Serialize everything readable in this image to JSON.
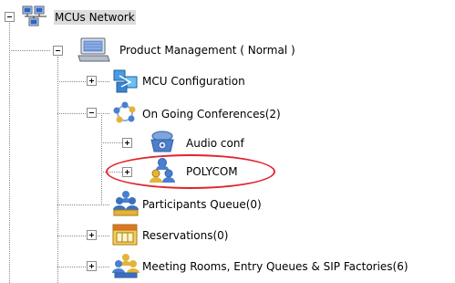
{
  "tree": {
    "root": {
      "label": "MCUs Network",
      "icon": "network-computers-icon"
    },
    "mcu": {
      "label": "Product Management  ( Normal )",
      "icon": "mcu-server-icon"
    },
    "items": [
      {
        "key": "mcu_config",
        "label": "MCU Configuration",
        "icon": "configuration-icon"
      },
      {
        "key": "ongoing",
        "label": "On Going Conferences(2)",
        "icon": "conferences-icon"
      },
      {
        "key": "audio_conf",
        "label": "Audio conf",
        "icon": "audio-conference-icon"
      },
      {
        "key": "polycom",
        "label": "POLYCOM",
        "icon": "video-conference-icon"
      },
      {
        "key": "participants",
        "label": "Participants Queue(0)",
        "icon": "participants-queue-icon"
      },
      {
        "key": "reservations",
        "label": "Reservations(0)",
        "icon": "calendar-icon"
      },
      {
        "key": "meeting_rooms",
        "label": "Meeting Rooms, Entry Queues & SIP Factories(6)",
        "icon": "meeting-rooms-icon"
      }
    ]
  },
  "colors": {
    "highlight": "#e0242c",
    "tree_line": "#8a8a8a",
    "selected_bg": "#dcdcdc"
  }
}
